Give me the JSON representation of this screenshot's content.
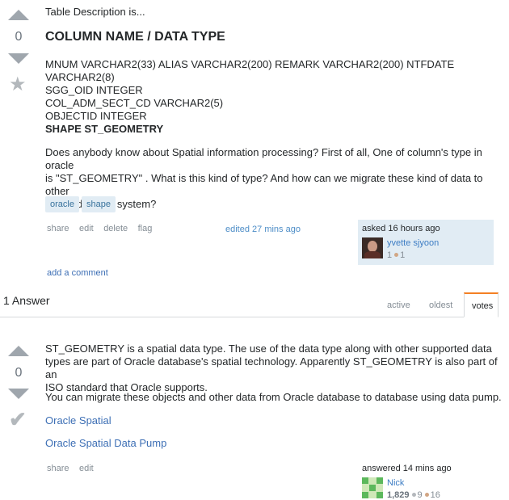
{
  "question": {
    "intro": "Table Description is...",
    "vote_count": "0",
    "heading": "COLUMN NAME / DATA TYPE",
    "columns": [
      "MNUM VARCHAR2(33) ALIAS VARCHAR2(200) REMARK VARCHAR2(200) NTFDATE",
      "VARCHAR2(8)",
      "SGG_OID INTEGER",
      "COL_ADM_SECT_CD VARCHAR2(5)",
      "OBJECTID INTEGER",
      "SHAPE ST_GEOMETRY"
    ],
    "body_lines": [
      "Does anybody know about Spatial information processing? First of all, One of column's type in oracle",
      "is \"ST_GEOMETRY\" . What is this kind of type? And how can we migrate these kind of data to other",
      "oracle databse system?"
    ],
    "tags": [
      "oracle",
      "shape"
    ],
    "menu": [
      "share",
      "edit",
      "delete",
      "flag"
    ],
    "edited": "edited 27 mins ago",
    "asked": "asked 16 hours ago",
    "user": {
      "name": "yvette sjyoon",
      "rep": "1",
      "bronze": "1"
    },
    "add_comment": "add a comment"
  },
  "answers_header": {
    "count": "1 Answer",
    "tabs": [
      "active",
      "oldest",
      "votes"
    ]
  },
  "answer": {
    "vote_count": "0",
    "para1_lines": [
      "ST_GEOMETRY is a spatial data type. The use of the data type along with other supported data",
      "types are part of Oracle database's spatial technology. Apparently ST_GEOMETRY is also part of an",
      "ISO standard that Oracle supports."
    ],
    "para2": "You can migrate these objects and other data from Oracle database to database using data pump.",
    "links": [
      "Oracle Spatial",
      "Oracle Spatial Data Pump"
    ],
    "menu": [
      "share",
      "edit"
    ],
    "answered": "answered 14 mins ago",
    "user": {
      "name": "Nick",
      "rep": "1,829",
      "silver": "9",
      "bronze": "16"
    }
  },
  "colors": {
    "accent": "#f48024",
    "link": "#3d6fb5",
    "tag_bg": "#e1ecf4",
    "sig_bg": "#e1ecf4",
    "silver": "#b4b8bc",
    "bronze": "#d1a684"
  }
}
